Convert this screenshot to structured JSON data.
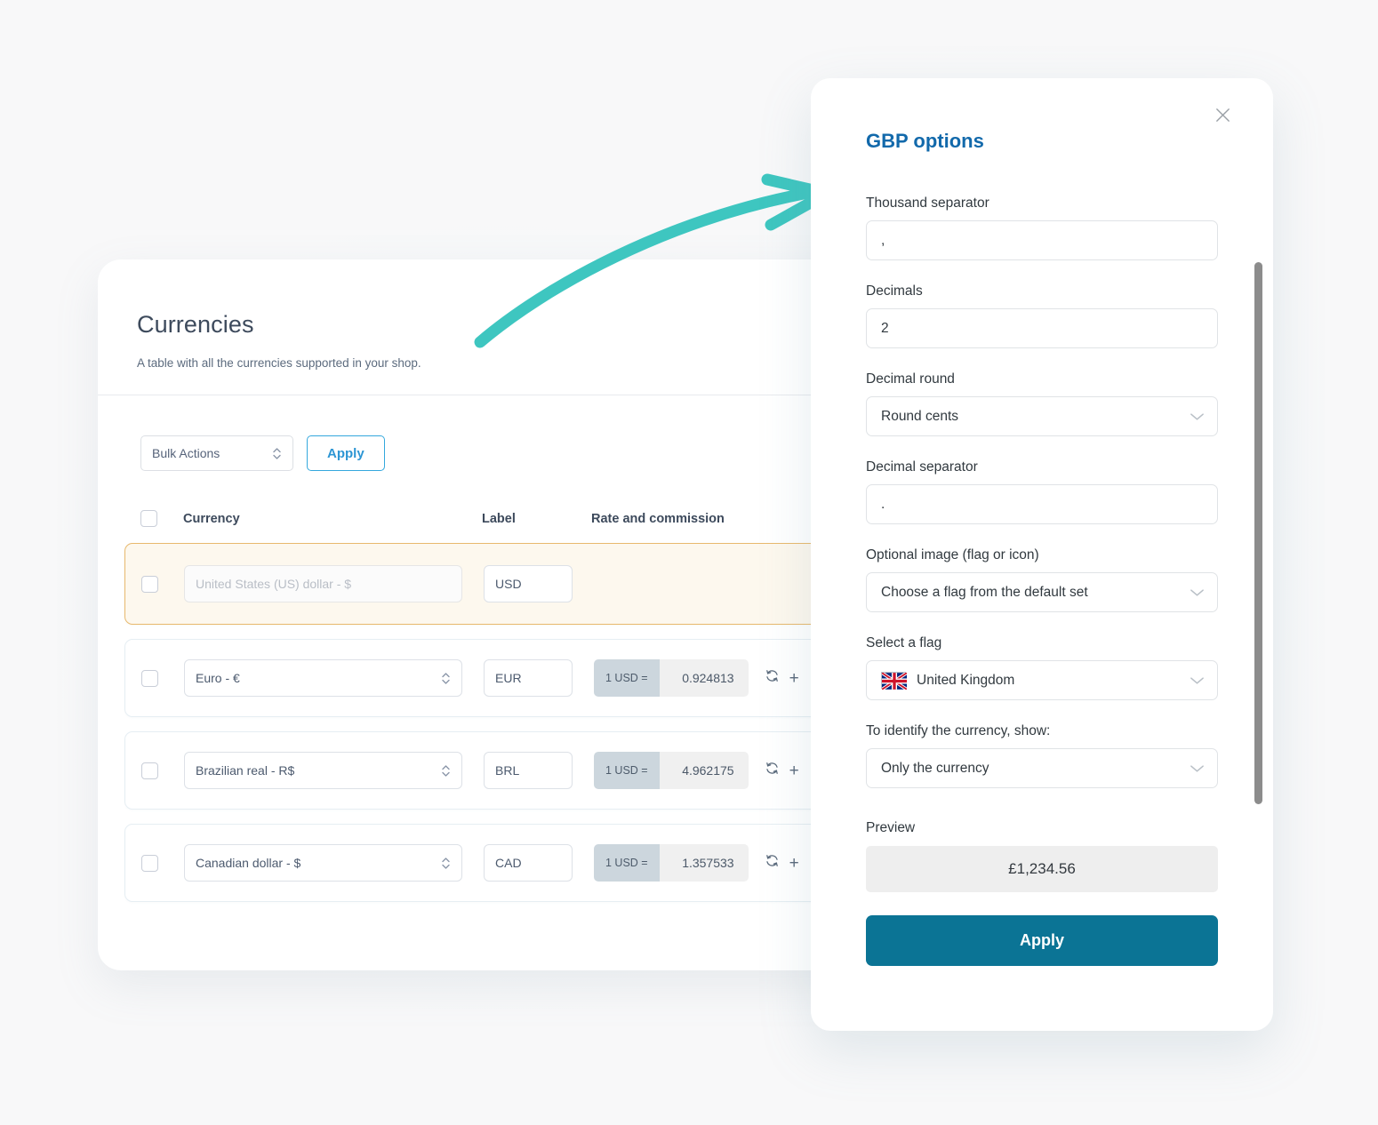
{
  "background": {
    "page_bg": "#f8f8f9",
    "glow_color": "#c8e8f0"
  },
  "currencies_card": {
    "title": "Currencies",
    "subtitle": "A table with all the currencies supported in your shop.",
    "toolbar": {
      "bulk_actions_label": "Bulk Actions",
      "bulk_actions_icon": "stepper-icon",
      "apply_label": "Apply"
    },
    "table": {
      "columns": [
        "Currency",
        "Label",
        "Rate and commission"
      ],
      "rows": [
        {
          "currency": "United States (US) dollar - $",
          "label": "USD",
          "rate_prefix": "",
          "rate_value": "",
          "highlight": true,
          "disabled": true
        },
        {
          "currency": "Euro - €",
          "label": "EUR",
          "rate_prefix": "1 USD =",
          "rate_value": "0.924813",
          "highlight": false,
          "disabled": false
        },
        {
          "currency": "Brazilian real - R$",
          "label": "BRL",
          "rate_prefix": "1 USD =",
          "rate_value": "4.962175",
          "highlight": false,
          "disabled": false
        },
        {
          "currency": "Canadian dollar - $",
          "label": "CAD",
          "rate_prefix": "1 USD =",
          "rate_value": "1.357533",
          "highlight": false,
          "disabled": false
        }
      ],
      "row_action_icons": [
        "refresh-icon",
        "plus-icon"
      ]
    }
  },
  "arrow": {
    "color": "#3ec6c0",
    "name": "curved-arrow-annotation"
  },
  "modal": {
    "title": "GBP options",
    "close_icon": "close-icon",
    "accent_color": "#1269ab",
    "fields": {
      "thousand_separator": {
        "label": "Thousand separator",
        "value": ","
      },
      "decimals": {
        "label": "Decimals",
        "value": "2"
      },
      "decimal_round": {
        "label": "Decimal round",
        "value": "Round cents"
      },
      "decimal_separator": {
        "label": "Decimal separator",
        "value": "."
      },
      "optional_image": {
        "label": "Optional image (flag or icon)",
        "value": "Choose a flag from the default set"
      },
      "select_flag": {
        "label": "Select a flag",
        "value": "United Kingdom",
        "flag_icon": "united-kingdom-flag-icon"
      },
      "identify_currency": {
        "label": "To identify the currency, show:",
        "value": "Only the currency"
      }
    },
    "preview": {
      "label": "Preview",
      "value": "£1,234.56"
    },
    "apply_label": "Apply",
    "apply_color": "#0b7495"
  }
}
